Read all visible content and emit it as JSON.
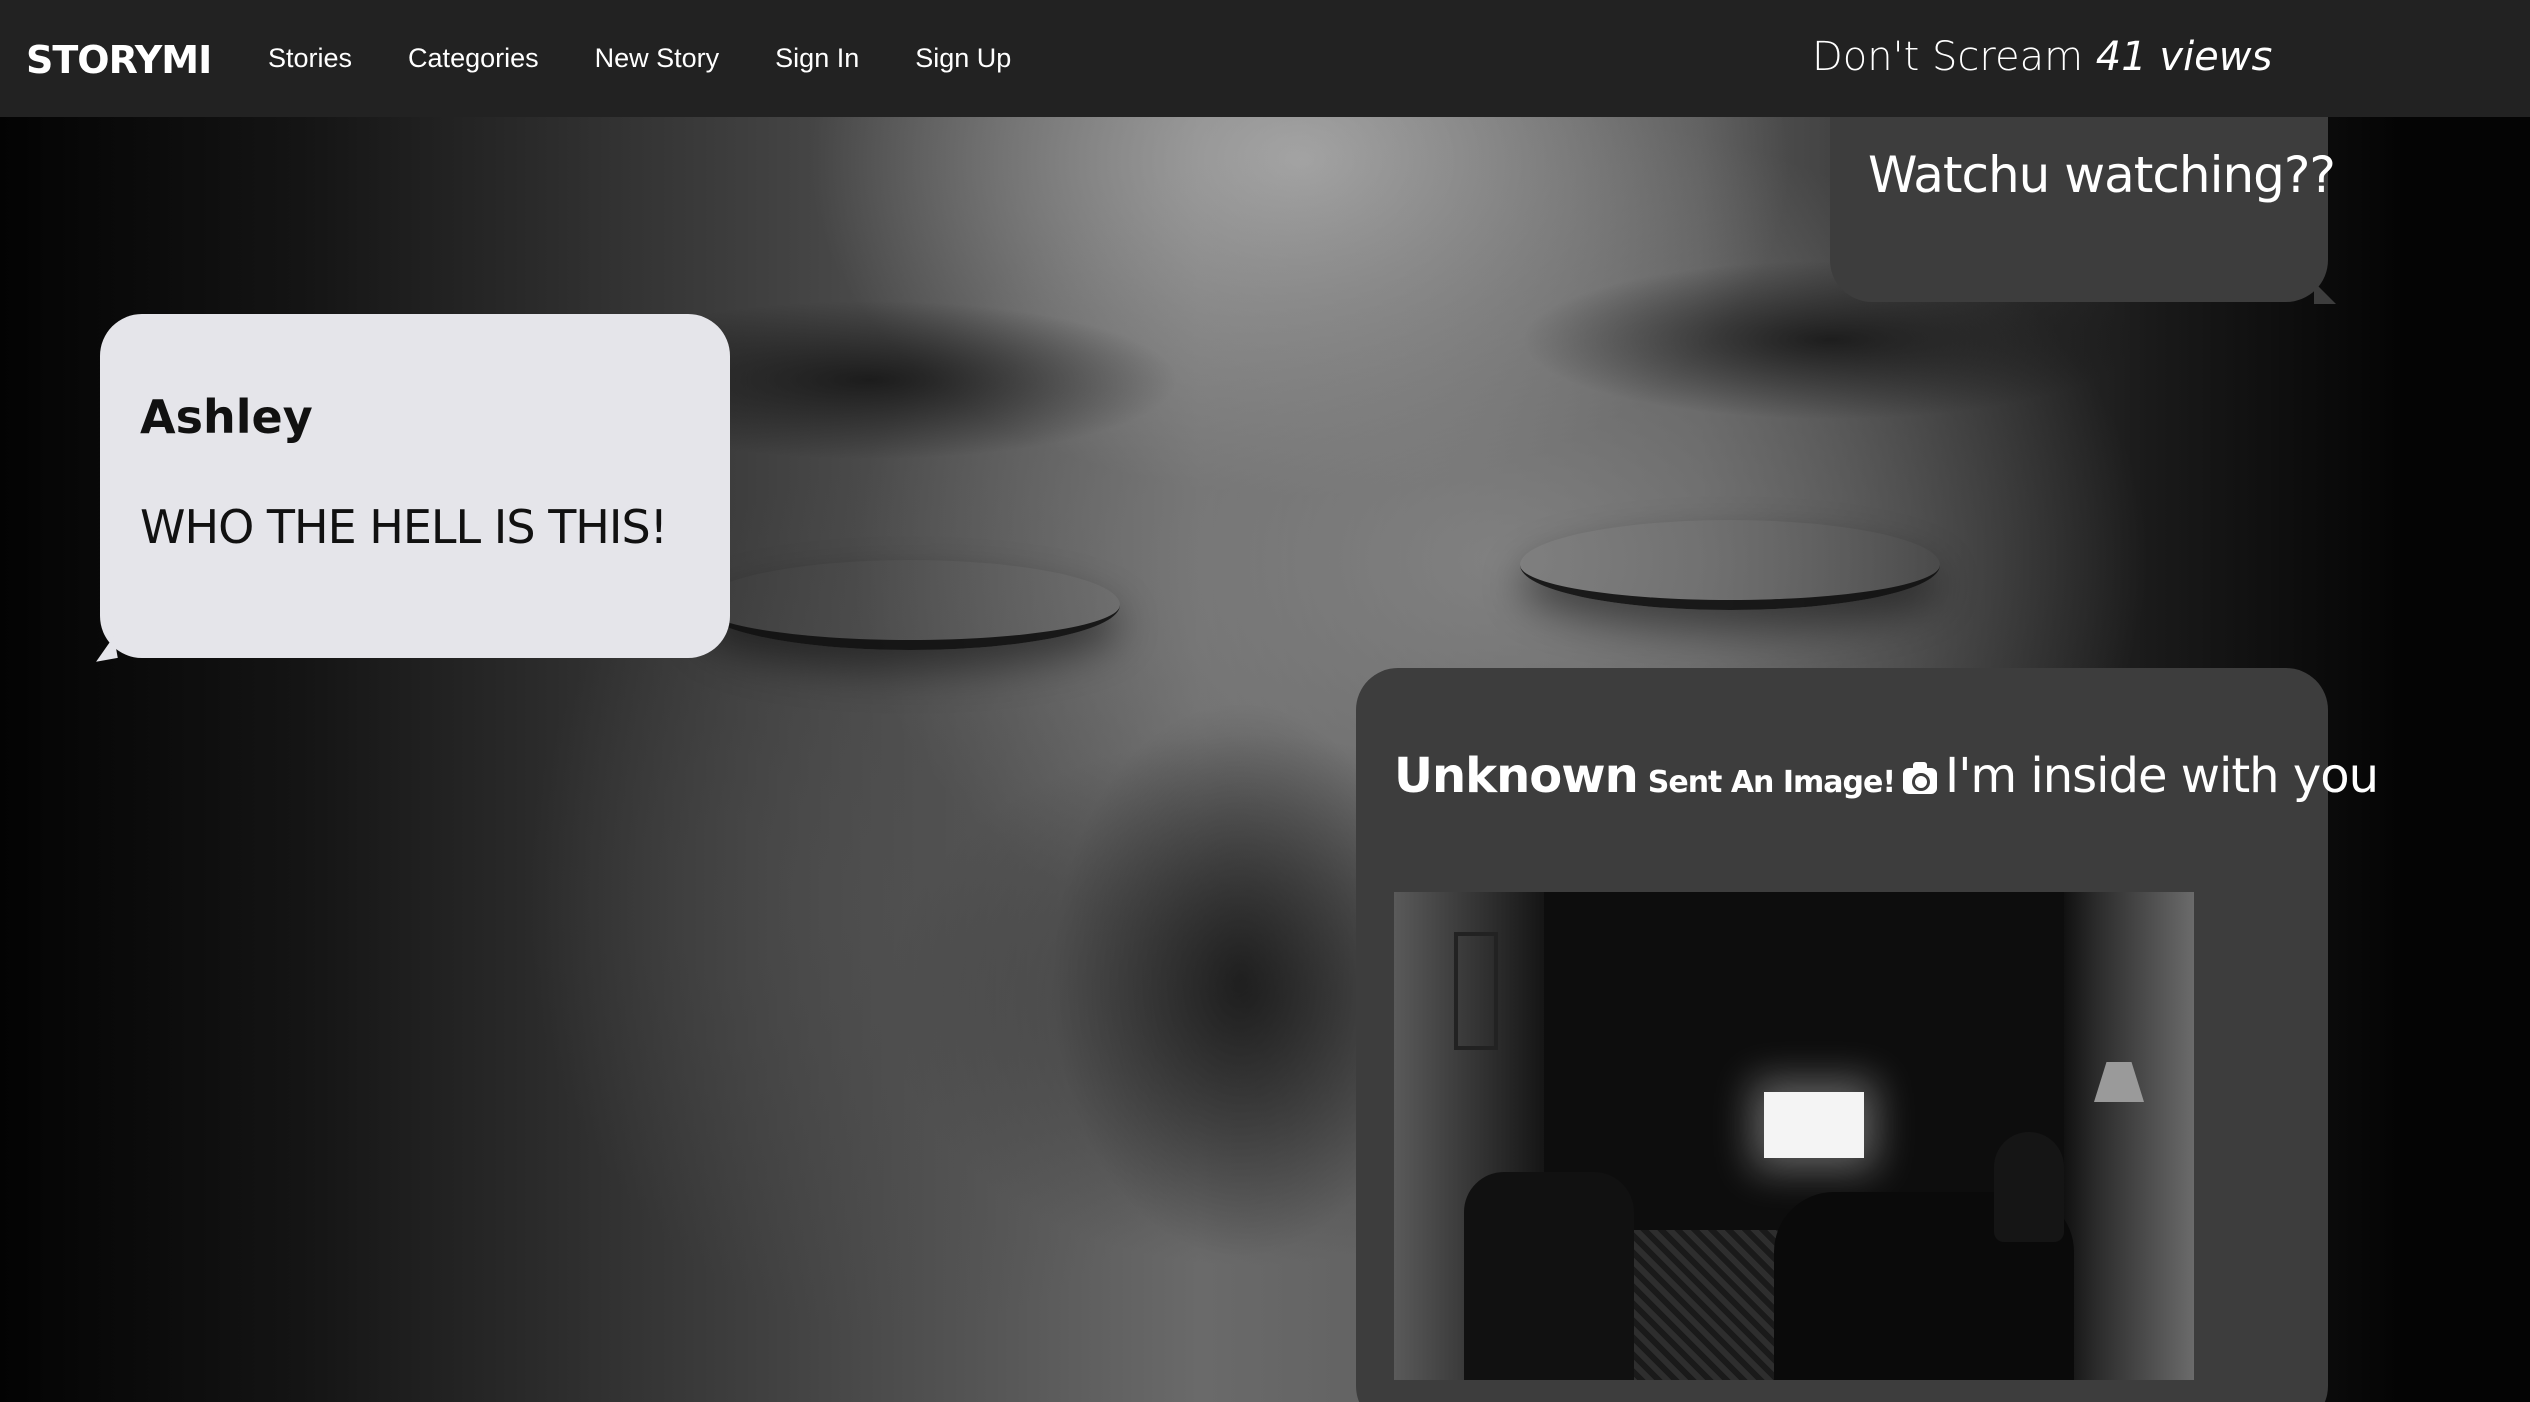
{
  "navbar": {
    "brand": "STORYMI",
    "links": [
      "Stories",
      "Categories",
      "New Story",
      "Sign In",
      "Sign Up"
    ]
  },
  "story": {
    "title": "Don't Scream",
    "views": "41 views"
  },
  "messages": [
    {
      "sender": "Ashley",
      "text": "WHO THE HELL IS THIS!",
      "side": "left"
    },
    {
      "sender": "",
      "text": "Watchu watching??",
      "side": "right"
    },
    {
      "sender": "Unknown",
      "note": "Sent An Image!",
      "icon": "camera-icon",
      "text": "I'm inside with you",
      "side": "right",
      "has_image": true
    }
  ],
  "colors": {
    "navbar_bg": "#222222",
    "bubble_incoming": "#e5e5ea",
    "bubble_outgoing": "#3d3d3d"
  }
}
